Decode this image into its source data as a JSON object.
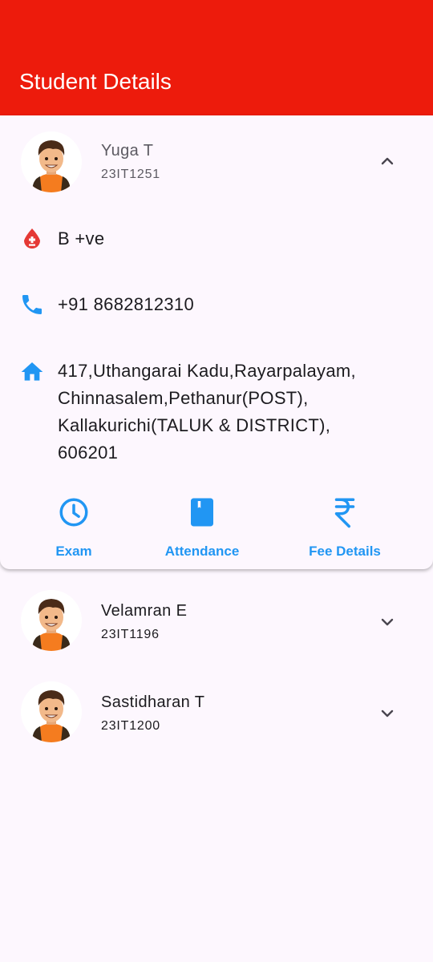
{
  "app_bar": {
    "title": "Student Details"
  },
  "students": [
    {
      "name": "Yuga T",
      "roll": "23IT1251",
      "expanded": true,
      "blood_group": "B +ve",
      "phone": "+91 8682812310",
      "address_lines": [
        "417,Uthangarai Kadu,Rayarpalayam,",
        "Chinnasalem,Pethanur(POST),",
        "Kallakurichi(TALUK & DISTRICT),",
        "606201"
      ]
    },
    {
      "name": "Velamran E",
      "roll": "23IT1196",
      "expanded": false
    },
    {
      "name": "Sastidharan T",
      "roll": "23IT1200",
      "expanded": false
    }
  ],
  "actions": [
    {
      "label": "Exam",
      "icon": "clock-icon"
    },
    {
      "label": "Attendance",
      "icon": "book-icon"
    },
    {
      "label": "Fee Details",
      "icon": "rupee-icon"
    }
  ],
  "colors": {
    "app_bar": "#ed1b0c",
    "accent": "#2196f3",
    "blood_icon": "#e53935",
    "background": "#fdf7fe"
  }
}
